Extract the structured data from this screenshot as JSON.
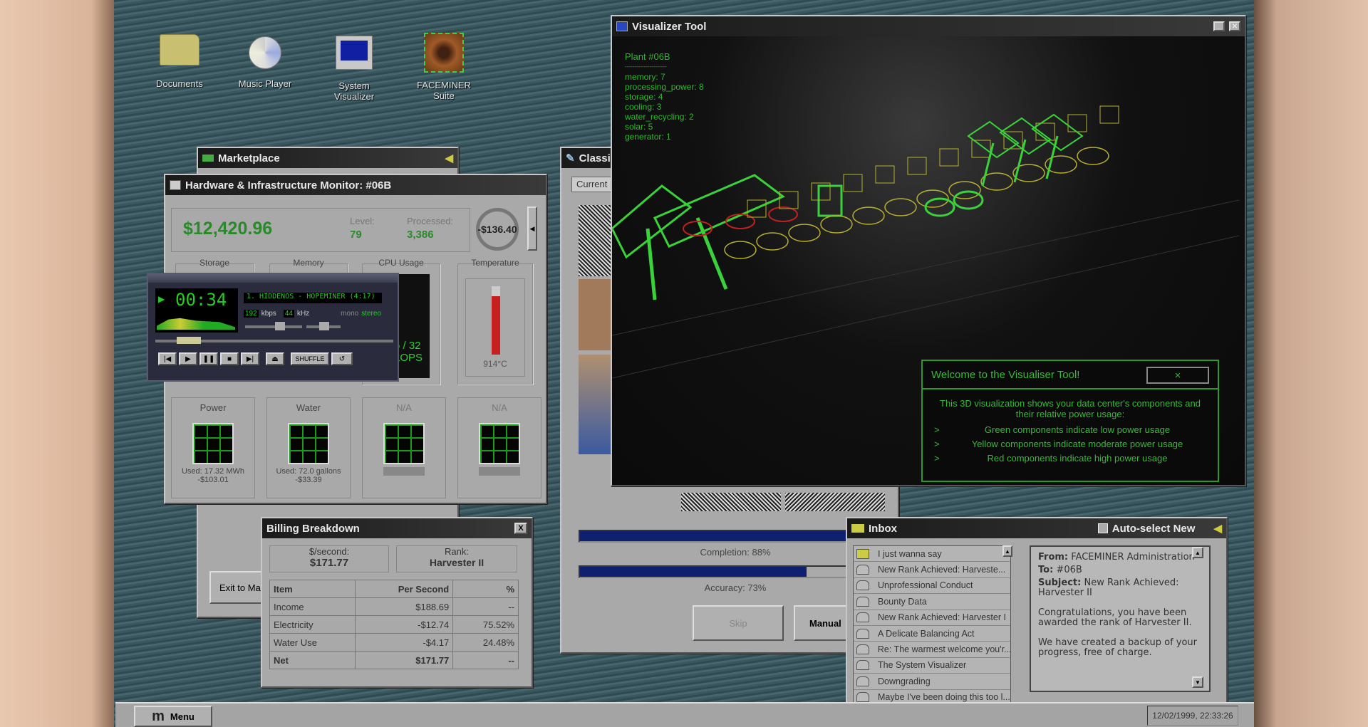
{
  "desktop": {
    "icons": [
      {
        "label": "Documents",
        "icon": "folder-icon"
      },
      {
        "label": "Music Player",
        "icon": "cd-music-icon"
      },
      {
        "label": "System Visualizer",
        "icon": "computer-icon"
      },
      {
        "label": "FACEMINER Suite",
        "icon": "eye-icon"
      }
    ]
  },
  "marketplace": {
    "title": "Marketplace",
    "exit_label": "Exit to Mark"
  },
  "monitor": {
    "title": "Hardware & Infrastructure Monitor: #06B",
    "balance": "$12,420.96",
    "level_label": "Level:",
    "level": "79",
    "processed_label": "Processed:",
    "processed": "3,386",
    "rate": "-$136.40",
    "storage_label": "Storage",
    "memory_label": "Memory",
    "cpu_label": "CPU Usage",
    "cpu_value": "6 / 32",
    "cpu_unit": "LOPS",
    "temp_label": "Temperature",
    "temp_value": "914°C",
    "temp_fill": 0.85,
    "panels": [
      {
        "label": "Power",
        "used": "Used: 17.32 MWh",
        "cost": "-$103.01"
      },
      {
        "label": "Water",
        "used": "Used: 72.0 gallons",
        "cost": "-$33.39"
      },
      {
        "label": "N/A"
      },
      {
        "label": "N/A"
      }
    ]
  },
  "player": {
    "time": "00:34",
    "track": "1. HIDDENOS - HOPEMINER (4:17)",
    "kbps": "192",
    "kbps_label": "kbps",
    "khz": "44",
    "khz_label": "kHz",
    "mono": "mono",
    "stereo": "stereo",
    "shuffle": "SHUFFLE"
  },
  "classifier": {
    "title": "Classi",
    "tab": "Current [",
    "completion": "Completion: 88%",
    "completion_value": 88,
    "accuracy": "Accuracy: 73%",
    "accuracy_value": 73,
    "skip": "Skip",
    "manual": "Manual"
  },
  "visualizer": {
    "title": "Visualizer Tool",
    "plant": "Plant #06B",
    "divider": "----------------------",
    "stats": [
      "memory: 7",
      "processing_power: 8",
      "storage: 4",
      "cooling: 3",
      "water_recycling: 2",
      "solar: 5",
      "generator: 1"
    ],
    "welcome": {
      "title": "Welcome to the Visualiser Tool!",
      "close": "×",
      "intro": "This 3D visualization shows your data center's components and their relative power usage:",
      "bullet": ">",
      "items": [
        "Green components indicate low power usage",
        "Yellow components indicate moderate power usage",
        "Red components indicate high power usage"
      ]
    },
    "colors": {
      "low": "#3ad23a",
      "moderate": "#b8b030",
      "high": "#c02020"
    }
  },
  "billing": {
    "title": "Billing Breakdown",
    "close": "X",
    "rate_label": "$/second:",
    "rate": "$171.77",
    "rank_label": "Rank:",
    "rank": "Harvester II",
    "headers": [
      "Item",
      "Per Second",
      "%"
    ],
    "rows": [
      [
        "Income",
        "$188.69",
        "--"
      ],
      [
        "Electricity",
        "-$12.74",
        "75.52%"
      ],
      [
        "Water Use",
        "-$4.17",
        "24.48%"
      ]
    ],
    "net": [
      "Net",
      "$171.77",
      "--"
    ]
  },
  "inbox": {
    "title": "Inbox",
    "auto_select": "Auto-select New",
    "messages": [
      "I just wanna say",
      "New Rank Achieved: Harveste...",
      "Unprofessional Conduct",
      "Bounty Data",
      "New Rank Achieved: Harvester I",
      "A Delicate Balancing Act",
      "Re: The warmest welcome you'r...",
      "The System Visualizer",
      "Downgrading",
      "Maybe I've been doing this too l..."
    ],
    "from_label": "From:",
    "from": "FACEMINER Administration",
    "to_label": "To:",
    "to": "#06B",
    "subject_label": "Subject:",
    "subject": "New Rank Achieved: Harvester II",
    "body1": "Congratulations, you have been awarded the rank of Harvester II.",
    "body2": "We have created a backup of your progress, free of charge."
  },
  "taskbar": {
    "menu": "Menu",
    "logo": "m",
    "clock": "12/02/1999, 22:33:26"
  }
}
